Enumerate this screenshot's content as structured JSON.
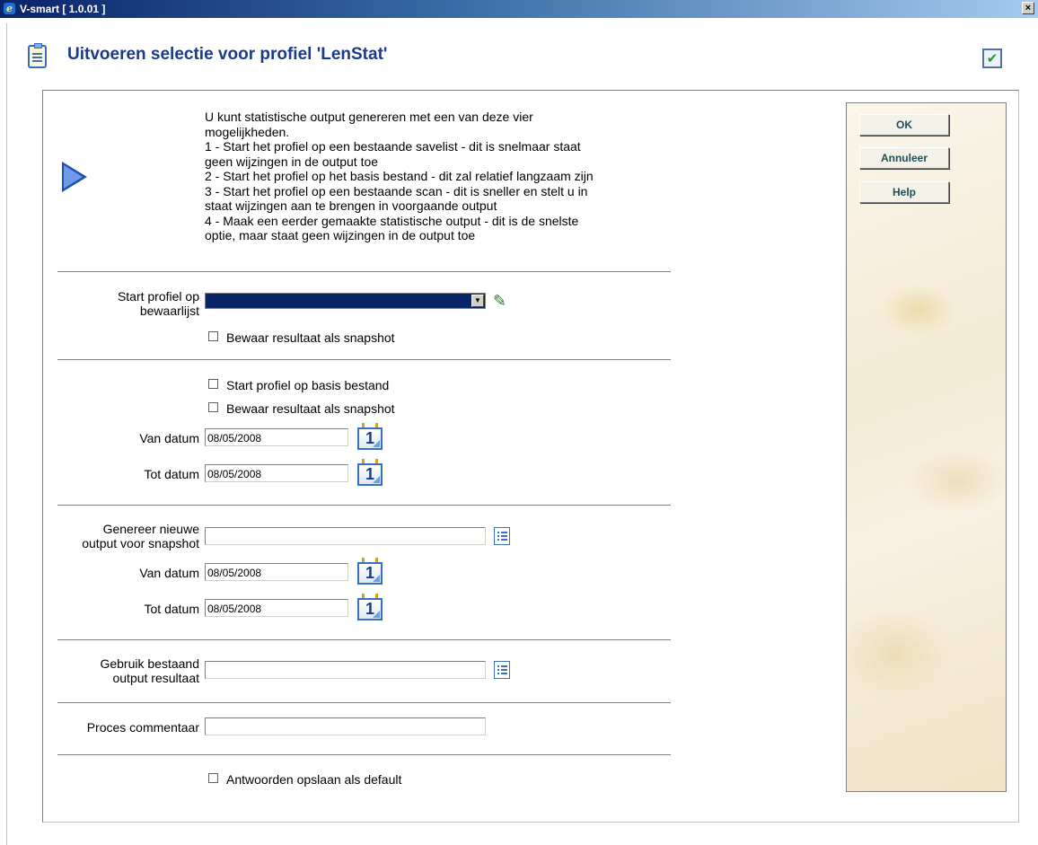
{
  "window": {
    "title": "V-smart [ 1.0.01 ]",
    "close_glyph": "×"
  },
  "page": {
    "title": "Uitvoeren selectie voor profiel 'LenStat'"
  },
  "description": {
    "lines": [
      "U kunt statistische output genereren met een van deze vier",
      "mogelijkheden.",
      "1 - Start het profiel op een bestaande savelist - dit is snelmaar staat",
      "geen wijzingen in de output toe",
      "2 - Start het profiel op het basis bestand - dit zal relatief langzaam zijn",
      "3 - Start het profiel op een bestaande scan - dit is sneller en stelt u in",
      "staat wijzingen aan te brengen in voorgaande output",
      "4 - Maak een eerder gemaakte statistische output - dit is de snelste",
      "optie, maar staat geen wijzingen in de output toe"
    ]
  },
  "section1": {
    "label_line1": "Start profiel op",
    "label_line2": "bewaarlijst",
    "select_value": "",
    "snapshot_label": "Bewaar resultaat als snapshot"
  },
  "section2": {
    "basis_label": "Start profiel op basis bestand",
    "snapshot_label": "Bewaar resultaat als snapshot",
    "van_label": "Van datum",
    "van_value": "08/05/2008",
    "tot_label": "Tot datum",
    "tot_value": "08/05/2008"
  },
  "section3": {
    "label_line1": "Genereer nieuwe",
    "label_line2": "output voor snapshot",
    "snapshot_value": "",
    "van_label": "Van datum",
    "van_value": "08/05/2008",
    "tot_label": "Tot datum",
    "tot_value": "08/05/2008"
  },
  "section4": {
    "label_line1": "Gebruik bestaand",
    "label_line2": "output resultaat",
    "value": ""
  },
  "section5": {
    "label": "Proces commentaar",
    "value": ""
  },
  "section6": {
    "default_label": "Antwoorden opslaan als default"
  },
  "buttons": {
    "ok": "OK",
    "cancel": "Annuleer",
    "help": "Help"
  },
  "calendar_glyph": "1"
}
